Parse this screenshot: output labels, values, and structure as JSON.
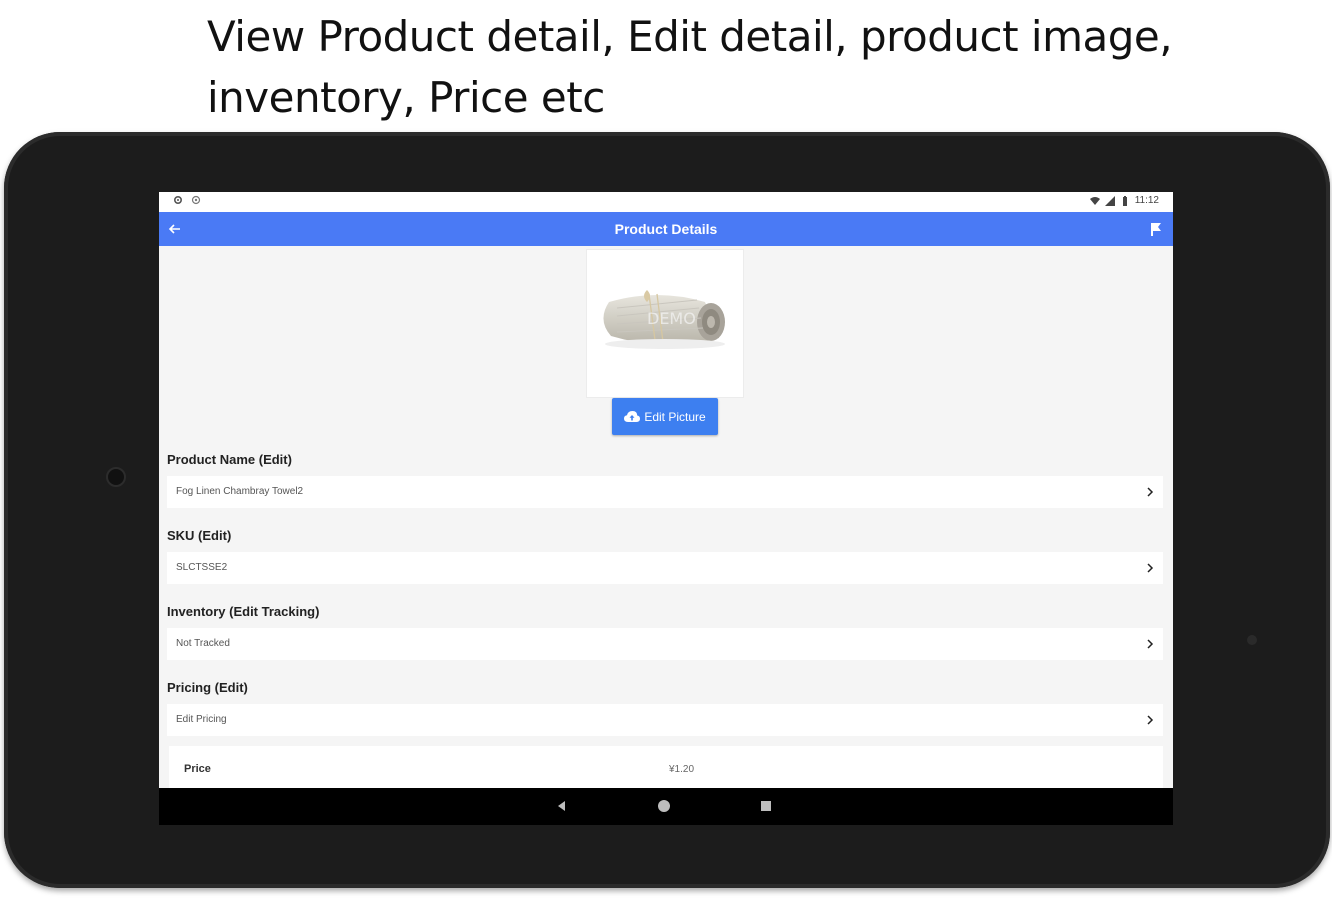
{
  "caption": {
    "line1": "View Product detail, Edit detail, product image,",
    "line2": "inventory, Price etc"
  },
  "status_bar": {
    "time": "11:12",
    "left_icons": [
      "settings-icon",
      "sync-icon"
    ],
    "right_icons": [
      "wifi-icon",
      "signal-icon",
      "battery-icon"
    ]
  },
  "app_bar": {
    "title": "Product Details",
    "back_icon": "arrow-left-icon",
    "action_icon": "flag-icon",
    "color": "#4a7af5"
  },
  "product_image": {
    "watermark": "DEMO"
  },
  "edit_picture_button": {
    "label": "Edit Picture",
    "icon": "cloud-upload-icon",
    "color": "#3d7ff0"
  },
  "sections": [
    {
      "label": "Product Name (Edit)",
      "value": "Fog Linen Chambray Towel2"
    },
    {
      "label": "SKU (Edit)",
      "value": "SLCTSSE2"
    },
    {
      "label": "Inventory (Edit Tracking)",
      "value": "Not Tracked"
    },
    {
      "label": "Pricing (Edit)",
      "value": "Edit Pricing"
    }
  ],
  "price": {
    "label": "Price",
    "value": "¥1.20"
  },
  "nav_bar": {
    "icons": [
      "back-triangle-icon",
      "home-circle-icon",
      "recents-square-icon"
    ]
  }
}
